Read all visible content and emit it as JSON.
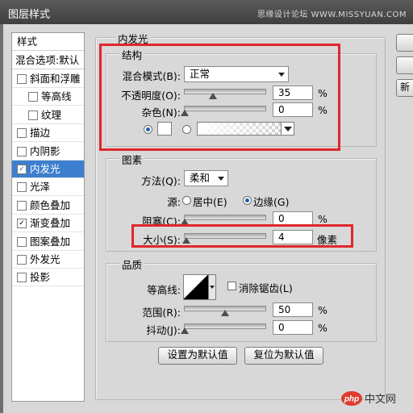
{
  "window": {
    "title": "图层样式",
    "watermark": "思缘设计论坛 WWW.MISSYUAN.COM"
  },
  "sidebar": {
    "header": "样式",
    "blend_options": "混合选项:默认",
    "items": [
      {
        "label": "斜面和浮雕",
        "checked": false
      },
      {
        "label": "等高线",
        "checked": false
      },
      {
        "label": "纹理",
        "checked": false
      },
      {
        "label": "描边",
        "checked": false
      },
      {
        "label": "内阴影",
        "checked": false
      },
      {
        "label": "内发光",
        "checked": true
      },
      {
        "label": "光泽",
        "checked": false
      },
      {
        "label": "颜色叠加",
        "checked": false
      },
      {
        "label": "渐变叠加",
        "checked": true
      },
      {
        "label": "图案叠加",
        "checked": false
      },
      {
        "label": "外发光",
        "checked": false
      },
      {
        "label": "投影",
        "checked": false
      }
    ],
    "check_mark": "✓",
    "selected_color": "#3d7fcf"
  },
  "panel": {
    "title": "内发光",
    "structure": {
      "title": "结构",
      "blend_mode_label": "混合模式(B):",
      "blend_mode_value": "正常",
      "opacity_label": "不透明度(O):",
      "opacity_value": "35",
      "opacity_unit": "%",
      "opacity_level": 0.35,
      "noise_label": "杂色(N):",
      "noise_value": "0",
      "noise_unit": "%",
      "noise_level": 0
    },
    "elements": {
      "title": "图素",
      "method_label": "方法(Q):",
      "method_value": "柔和",
      "source_label": "源:",
      "source_center": "居中(E)",
      "source_edge": "边缘(G)",
      "choke_label": "阻塞(C):",
      "choke_value": "0",
      "choke_unit": "%",
      "choke_level": 0,
      "size_label": "大小(S):",
      "size_value": "4",
      "size_unit": "像素",
      "size_level": 0.02
    },
    "quality": {
      "title": "品质",
      "contour_label": "等高线:",
      "antialias_label": "消除锯齿(L)",
      "range_label": "范围(R):",
      "range_value": "50",
      "range_unit": "%",
      "range_level": 0.5,
      "jitter_label": "抖动(J):",
      "jitter_value": "0",
      "jitter_unit": "%",
      "jitter_level": 0
    },
    "buttons": {
      "set_default": "设置为默认值",
      "reset_default": "复位为默认值"
    }
  },
  "right_buttons": {
    "new_style_partial": "新"
  },
  "logo": {
    "text": "php中文网"
  },
  "colors": {
    "highlight_red": "#e0262c",
    "dialog_bg": "#d8d8d8"
  }
}
